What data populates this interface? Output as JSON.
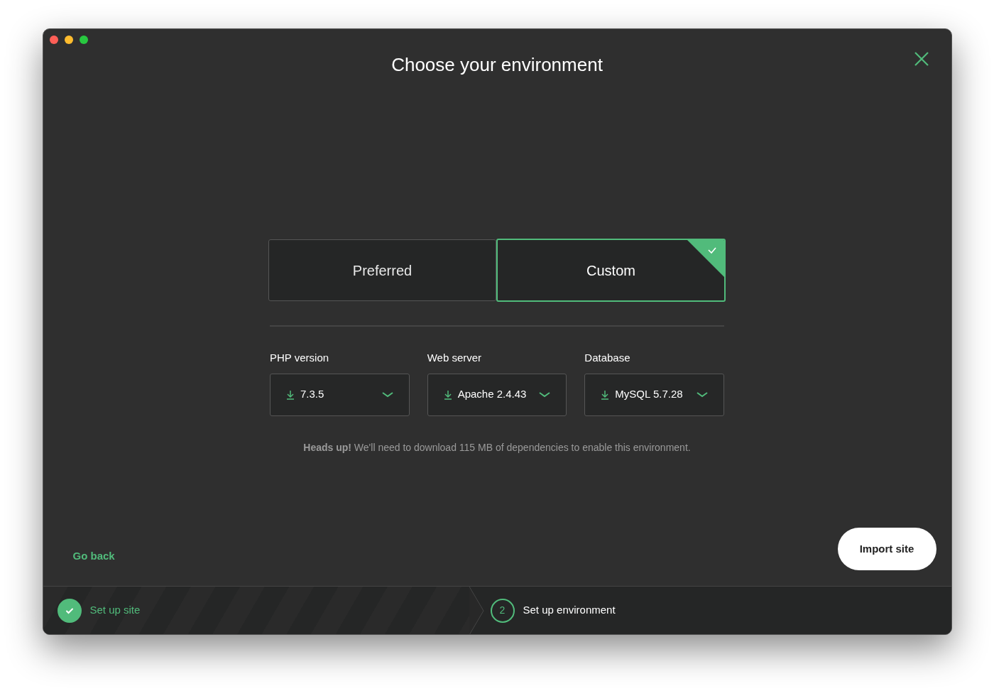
{
  "window": {
    "title": "Choose your environment"
  },
  "environment_options": [
    {
      "label": "Preferred",
      "selected": false
    },
    {
      "label": "Custom",
      "selected": true
    }
  ],
  "selects": [
    {
      "label": "PHP version",
      "value": "7.3.5"
    },
    {
      "label": "Web server",
      "value": "Apache 2.4.43"
    },
    {
      "label": "Database",
      "value": "MySQL 5.7.28"
    }
  ],
  "notice": "**Heads up!** We'll need to download 115 MB of dependencies to enable this environment.",
  "go_back": "Go back",
  "import_button": "Import site",
  "steps": [
    {
      "label": "Set up site",
      "kind": "done"
    },
    {
      "label": "Set up environment",
      "kind": "current",
      "number": "2"
    }
  ]
}
